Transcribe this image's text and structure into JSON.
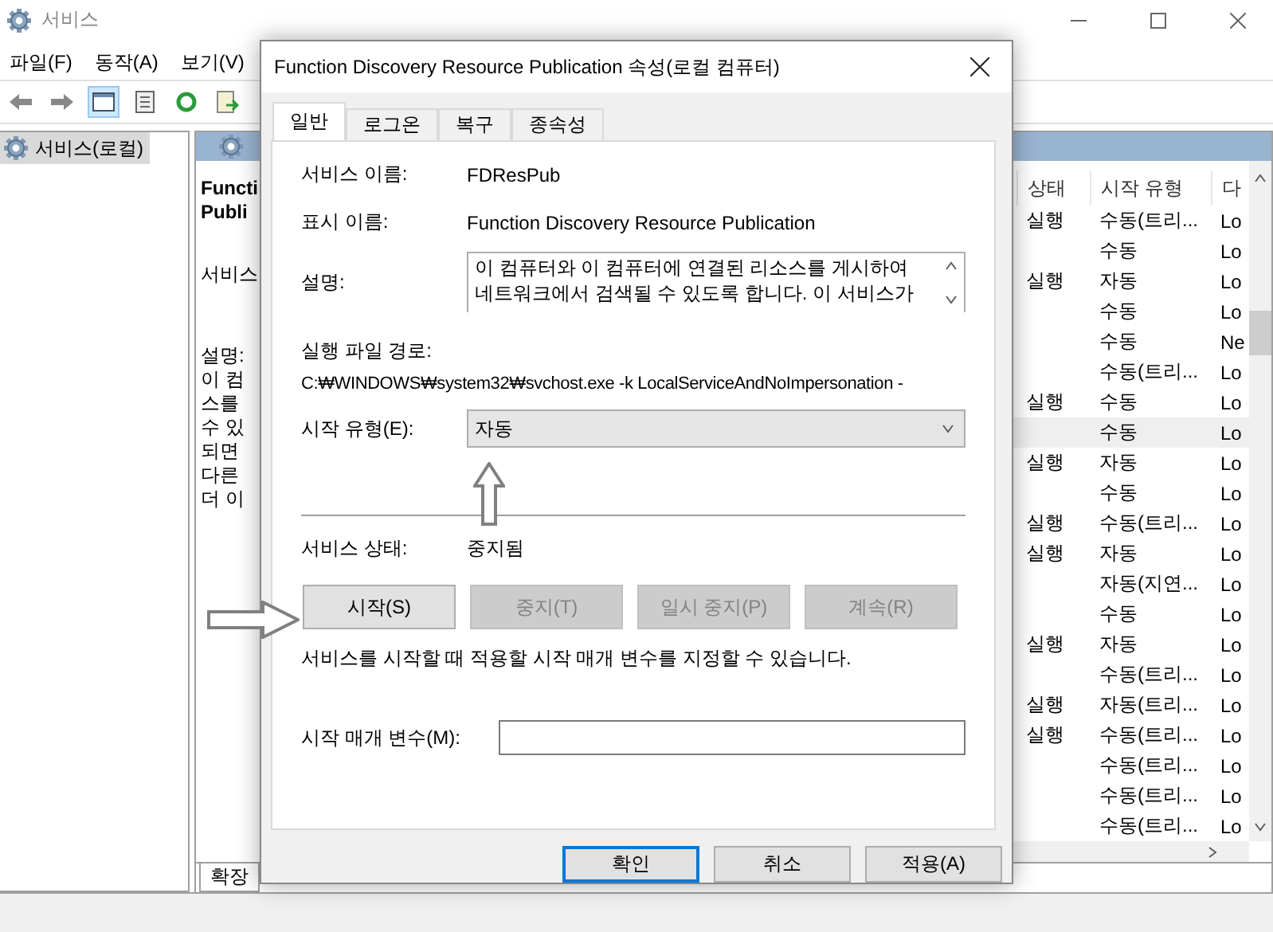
{
  "window": {
    "title": "서비스"
  },
  "menu": [
    "파일(F)",
    "동작(A)",
    "보기(V)"
  ],
  "sidebar": {
    "items": [
      {
        "label": "서비스(로컬)",
        "selected": true
      }
    ]
  },
  "detail_pane": {
    "title_lines": [
      "Functi",
      "Publi"
    ],
    "lines": [
      "서비스",
      "설명:",
      "이 컴",
      "스를",
      "수 있",
      "되면",
      "다른",
      "더 이"
    ]
  },
  "table": {
    "columns": [
      "상태",
      "시작 유형",
      "다"
    ],
    "rows": [
      {
        "cells": [
          "실행",
          "수동(트리...",
          "Lo"
        ],
        "selected": false
      },
      {
        "cells": [
          "",
          "수동",
          "Lo"
        ],
        "selected": false
      },
      {
        "cells": [
          "실행",
          "자동",
          "Lo"
        ],
        "selected": false
      },
      {
        "cells": [
          "",
          "수동",
          "Lo"
        ],
        "selected": false
      },
      {
        "cells": [
          "",
          "수동",
          "Ne"
        ],
        "selected": false
      },
      {
        "cells": [
          "",
          "수동(트리...",
          "Lo"
        ],
        "selected": false
      },
      {
        "cells": [
          "실행",
          "수동",
          "Lo"
        ],
        "selected": false
      },
      {
        "cells": [
          "",
          "수동",
          "Lo"
        ],
        "selected": true
      },
      {
        "cells": [
          "실행",
          "자동",
          "Lo"
        ],
        "selected": false
      },
      {
        "cells": [
          "",
          "수동",
          "Lo"
        ],
        "selected": false
      },
      {
        "cells": [
          "실행",
          "수동(트리...",
          "Lo"
        ],
        "selected": false
      },
      {
        "cells": [
          "실행",
          "자동",
          "Lo"
        ],
        "selected": false
      },
      {
        "cells": [
          "",
          "자동(지연...",
          "Lo"
        ],
        "selected": false
      },
      {
        "cells": [
          "",
          "수동",
          "Lo"
        ],
        "selected": false
      },
      {
        "cells": [
          "실행",
          "자동",
          "Lo"
        ],
        "selected": false
      },
      {
        "cells": [
          "",
          "수동(트리...",
          "Lo"
        ],
        "selected": false
      },
      {
        "cells": [
          "실행",
          "자동(트리...",
          "Lo"
        ],
        "selected": false
      },
      {
        "cells": [
          "실행",
          "수동(트리...",
          "Lo"
        ],
        "selected": false
      },
      {
        "cells": [
          "",
          "수동(트리...",
          "Lo"
        ],
        "selected": false
      },
      {
        "cells": [
          "",
          "수동(트리...",
          "Lo"
        ],
        "selected": false
      },
      {
        "cells": [
          "",
          "수동(트리...",
          "Lo"
        ],
        "selected": false
      }
    ]
  },
  "bottom_tabs": [
    {
      "label": "확장"
    }
  ],
  "dialog": {
    "title": "Function Discovery Resource Publication 속성(로컬 컴퓨터)",
    "tabs": [
      {
        "label": "일반",
        "selected": true
      },
      {
        "label": "로그온",
        "selected": false
      },
      {
        "label": "복구",
        "selected": false
      },
      {
        "label": "종속성",
        "selected": false
      }
    ],
    "service_name": {
      "label": "서비스 이름:",
      "value": "FDResPub"
    },
    "display_name": {
      "label": "표시 이름:",
      "value": "Function Discovery Resource Publication"
    },
    "description": {
      "label": "설명:",
      "value": "이 컴퓨터와 이 컴퓨터에 연결된 리소스를 게시하여 네트워크에서 검색될 수 있도록 합니다. 이 서비스가"
    },
    "path": {
      "label": "실행 파일 경로:",
      "value": "C:₩WINDOWS₩system32₩svchost.exe -k LocalServiceAndNoImpersonation -"
    },
    "startup_type": {
      "label": "시작 유형(E):",
      "value": "자동"
    },
    "status": {
      "label": "서비스 상태:",
      "value": "중지됨"
    },
    "service_buttons": [
      {
        "label": "시작(S)",
        "disabled": false
      },
      {
        "label": "중지(T)",
        "disabled": true
      },
      {
        "label": "일시 중지(P)",
        "disabled": true
      },
      {
        "label": "계속(R)",
        "disabled": true
      }
    ],
    "hint": "서비스를 시작할 때 적용할 시작 매개 변수를 지정할 수 있습니다.",
    "parameters": {
      "label": "시작 매개 변수(M):"
    },
    "footer_buttons": [
      {
        "label": "확인",
        "default": true
      },
      {
        "label": "취소",
        "default": false
      },
      {
        "label": "적용(A)",
        "default": false
      }
    ]
  }
}
